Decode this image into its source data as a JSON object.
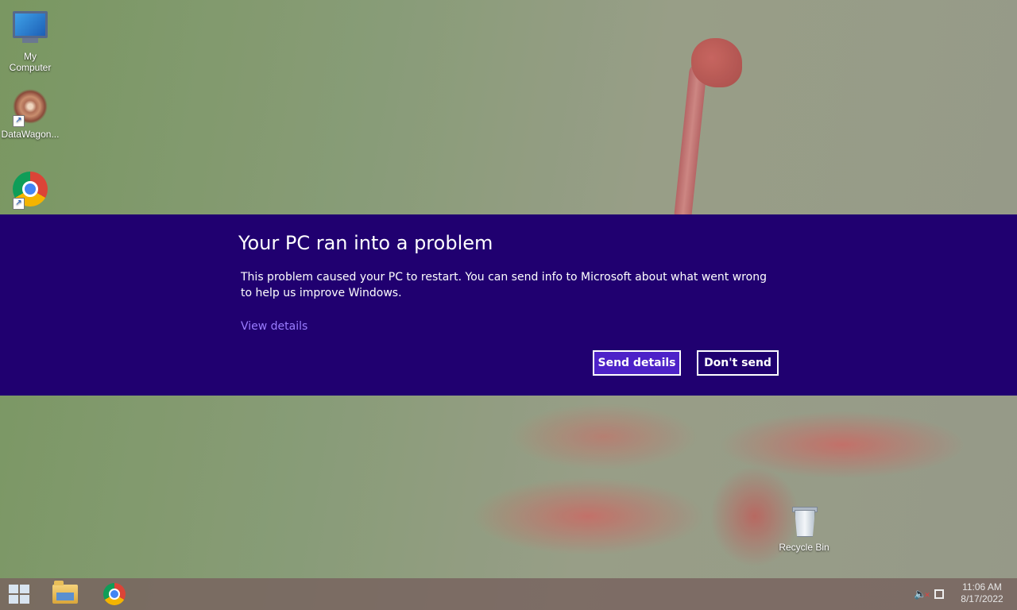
{
  "desktop": {
    "icons": [
      {
        "label": "My\nComputer",
        "icon": "my-computer-icon"
      },
      {
        "label": "DataWagon...",
        "icon": "datawagon-icon"
      },
      {
        "label": "",
        "icon": "chrome-icon"
      },
      {
        "label": "Recycle Bin",
        "icon": "recycle-bin-icon"
      }
    ]
  },
  "dialog": {
    "title": "Your PC ran into a problem",
    "message": "This problem caused your PC to restart. You can send info to Microsoft about what went wrong to help us improve Windows.",
    "view_details_label": "View details",
    "send_label": "Send details",
    "dont_send_label": "Don't send",
    "background_color": "#200070",
    "accent_button_color": "#4d22c8",
    "link_color": "#9a7dff"
  },
  "taskbar": {
    "start_icon": "windows-start-icon",
    "pinned": [
      "file-explorer-icon",
      "chrome-icon"
    ],
    "tray_icons": [
      "volume-muted-icon",
      "network-icon"
    ],
    "time": "11:06 AM",
    "date": "8/17/2022"
  }
}
